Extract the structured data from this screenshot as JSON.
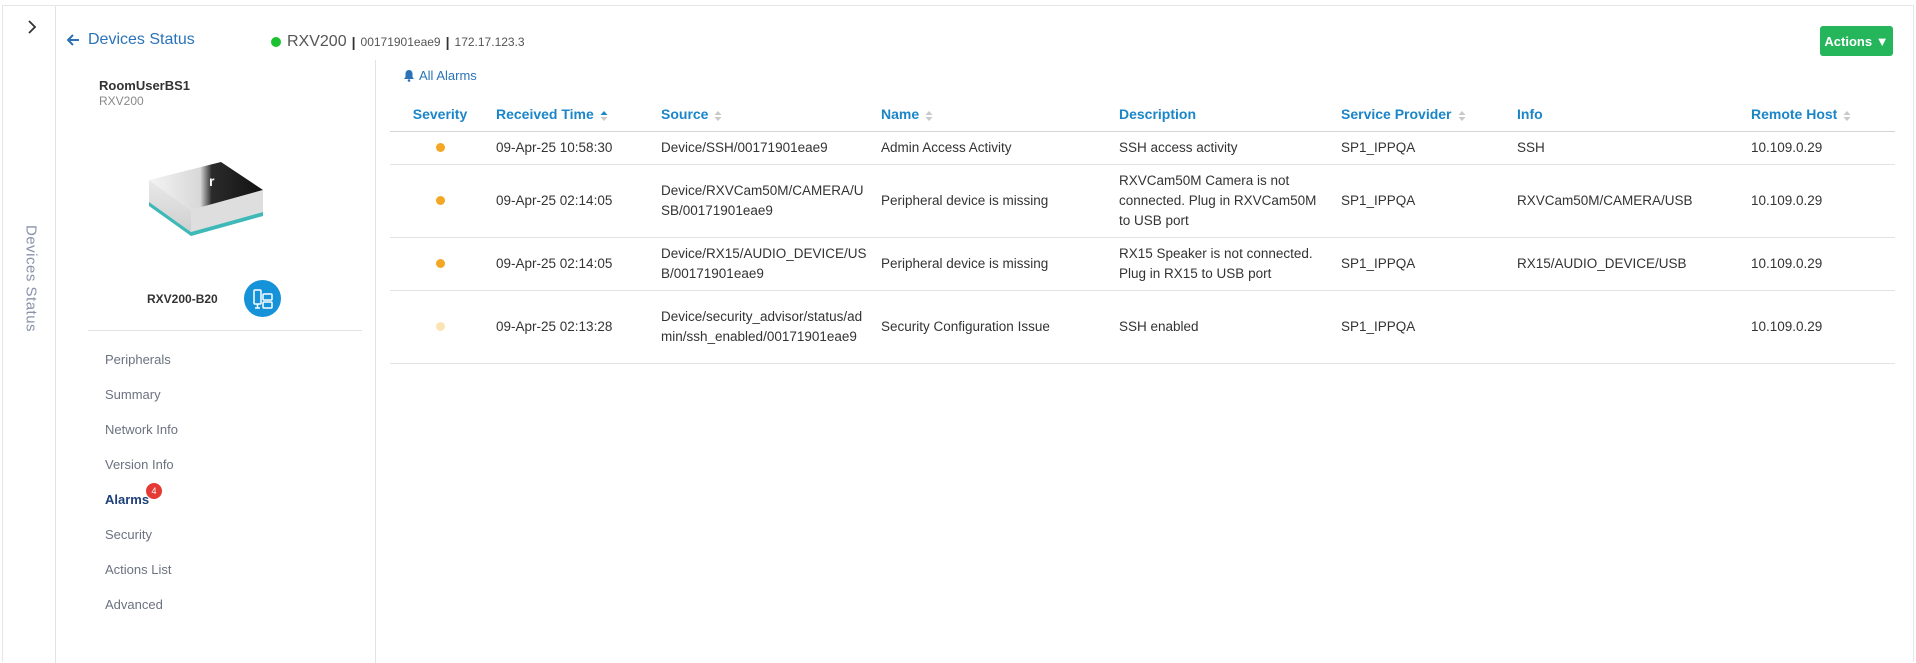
{
  "rail": {
    "title": "Devices Status",
    "toggle_icon": "chevron-right-icon"
  },
  "header": {
    "back_label": "Devices Status",
    "device_model": "RXV200",
    "device_serial": "00171901eae9",
    "device_ip": "172.17.123.3",
    "status_color": "#19c22e",
    "actions_label": "Actions ▼"
  },
  "side": {
    "room_name": "RoomUserBS1",
    "room_model": "RXV200",
    "device_label": "RXV200-B20",
    "menu": [
      {
        "label": "Peripherals"
      },
      {
        "label": "Summary"
      },
      {
        "label": "Network Info"
      },
      {
        "label": "Version Info"
      },
      {
        "label": "Alarms",
        "badge": "4",
        "active": true
      },
      {
        "label": "Security"
      },
      {
        "label": "Actions List"
      },
      {
        "label": "Advanced"
      }
    ]
  },
  "main": {
    "all_alarms_label": "All Alarms",
    "columns": [
      "Severity",
      "Received Time",
      "Source",
      "Name",
      "Description",
      "Service Provider",
      "Info",
      "Remote Host"
    ],
    "rows": [
      {
        "severity_color": "#f5a623",
        "time": "09-Apr-25 10:58:30",
        "source": "Device/SSH/00171901eae9",
        "name": "Admin Access Activity",
        "description": "SSH access activity",
        "provider": "SP1_IPPQA",
        "info": "SSH",
        "host": "10.109.0.29"
      },
      {
        "severity_color": "#f5a623",
        "time": "09-Apr-25 02:14:05",
        "source": "Device/RXVCam50M/CAMERA/USB/00171901eae9",
        "name": "Peripheral device is missing",
        "description": "RXVCam50M Camera is not connected. Plug in RXVCam50M to USB port",
        "provider": "SP1_IPPQA",
        "info": "RXVCam50M/CAMERA/USB",
        "host": "10.109.0.29"
      },
      {
        "severity_color": "#f5a623",
        "time": "09-Apr-25 02:14:05",
        "source": "Device/RX15/AUDIO_DEVICE/USB/00171901eae9",
        "name": "Peripheral device is missing",
        "description": "RX15 Speaker is not connected. Plug in RX15 to USB port",
        "provider": "SP1_IPPQA",
        "info": "RX15/AUDIO_DEVICE/USB",
        "host": "10.109.0.29"
      },
      {
        "severity_color": "#fbe3b3",
        "time": "09-Apr-25 02:13:28",
        "source": "Device/security_advisor/status/admin/ssh_enabled/00171901eae9",
        "name": "Security Configuration Issue",
        "description": "SSH enabled",
        "provider": "SP1_IPPQA",
        "info": "",
        "host": "10.109.0.29"
      }
    ]
  }
}
